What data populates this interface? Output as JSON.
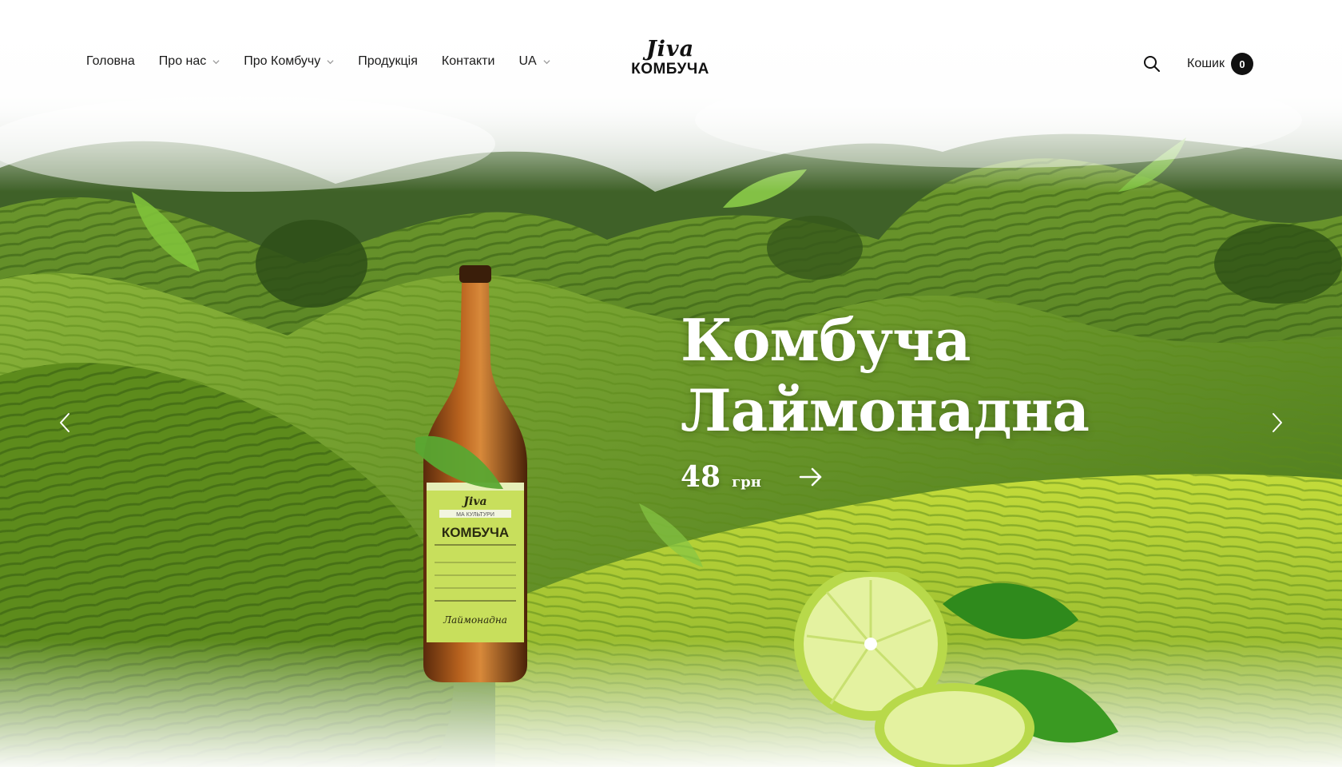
{
  "nav": {
    "items": [
      {
        "label": "Головна",
        "has_dropdown": false
      },
      {
        "label": "Про нас",
        "has_dropdown": true
      },
      {
        "label": "Про Комбучу",
        "has_dropdown": true
      },
      {
        "label": "Продукція",
        "has_dropdown": false
      },
      {
        "label": "Контакти",
        "has_dropdown": false
      },
      {
        "label": "UA",
        "has_dropdown": true
      }
    ]
  },
  "logo": {
    "script": "Jiva",
    "word": "КОМБУЧА"
  },
  "cart": {
    "label": "Кошик",
    "count": "0"
  },
  "hero": {
    "title_line1": "Комбуча",
    "title_line2": "Лаймонадна",
    "price_value": "48",
    "price_currency": "грн"
  },
  "bottle_label": {
    "brand": "Jiva",
    "band": "МА КУЛЬТУРИ",
    "name": "КОМБУЧА",
    "flavor": "Лаймонадна"
  },
  "colors": {
    "accent": "#b8d957",
    "text": "#1a1a1a",
    "hero_text": "#ffffff"
  }
}
